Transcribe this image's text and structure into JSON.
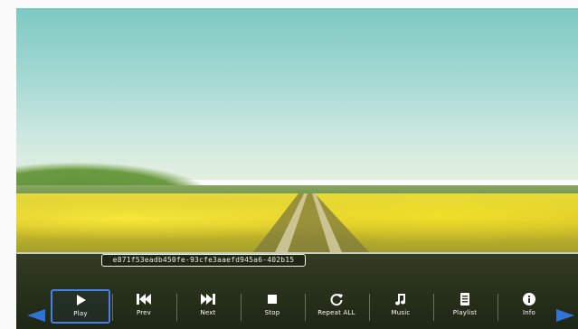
{
  "player": {
    "filename": "e871f53eadb450fe-93cfe3aaefd945a6-402b15",
    "controls": [
      {
        "label": "Play",
        "icon": "play-icon"
      },
      {
        "label": "Prev",
        "icon": "previous-icon"
      },
      {
        "label": "Next",
        "icon": "next-icon"
      },
      {
        "label": "Stop",
        "icon": "stop-icon"
      },
      {
        "label": "Repeat ALL",
        "icon": "repeat-icon"
      },
      {
        "label": "Music",
        "icon": "music-note-icon"
      },
      {
        "label": "Playlist",
        "icon": "playlist-icon"
      },
      {
        "label": "Info",
        "icon": "info-icon"
      }
    ],
    "selected_control": "Play",
    "accent_color": "#4b7fe0"
  }
}
